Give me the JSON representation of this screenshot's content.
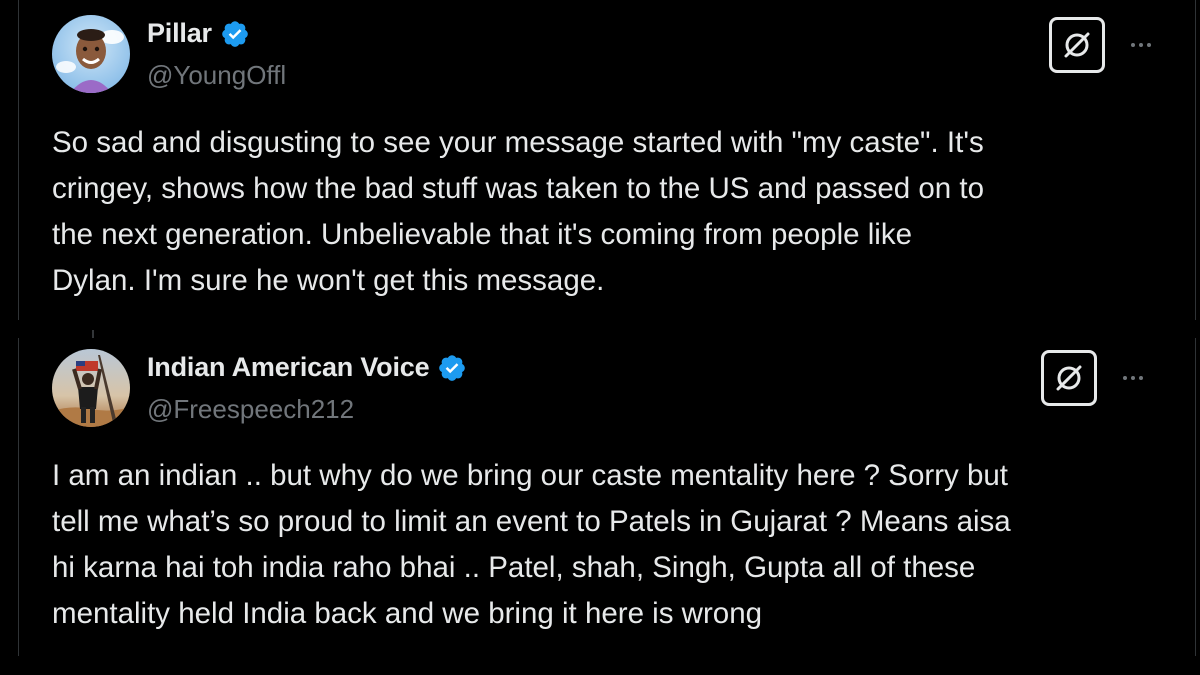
{
  "tweets": [
    {
      "display_name": "Pillar",
      "handle": "@YoungOffl",
      "verified": true,
      "text": "So sad and disgusting to see your message started with \"my caste\". It's\ncringey, shows how the bad stuff was taken to the US and passed on to\nthe next generation. Unbelievable that it's coming from people like\nDylan. I'm sure he won't get this message.",
      "icons": {
        "verified": "verified-badge-icon",
        "grok": "grok-icon",
        "more": "more-options-icon"
      }
    },
    {
      "display_name": "Indian American Voice",
      "handle": "@Freespeech212",
      "verified": true,
      "text": "I am an indian .. but why do we bring our caste mentality here ? Sorry but\ntell me what’s so proud to limit an event to Patels in Gujarat ? Means aisa\nhi karna hai toh india raho bhai .. Patel, shah, Singh, Gupta all of these\nmentality held India back and we bring it here is wrong",
      "icons": {
        "verified": "verified-badge-icon",
        "grok": "grok-icon",
        "more": "more-options-icon"
      }
    }
  ],
  "colors": {
    "background": "#000000",
    "primary_text": "#e7e9ea",
    "secondary_text": "#71767b",
    "verified_blue": "#1d9bf0",
    "border": "#2f3336"
  }
}
